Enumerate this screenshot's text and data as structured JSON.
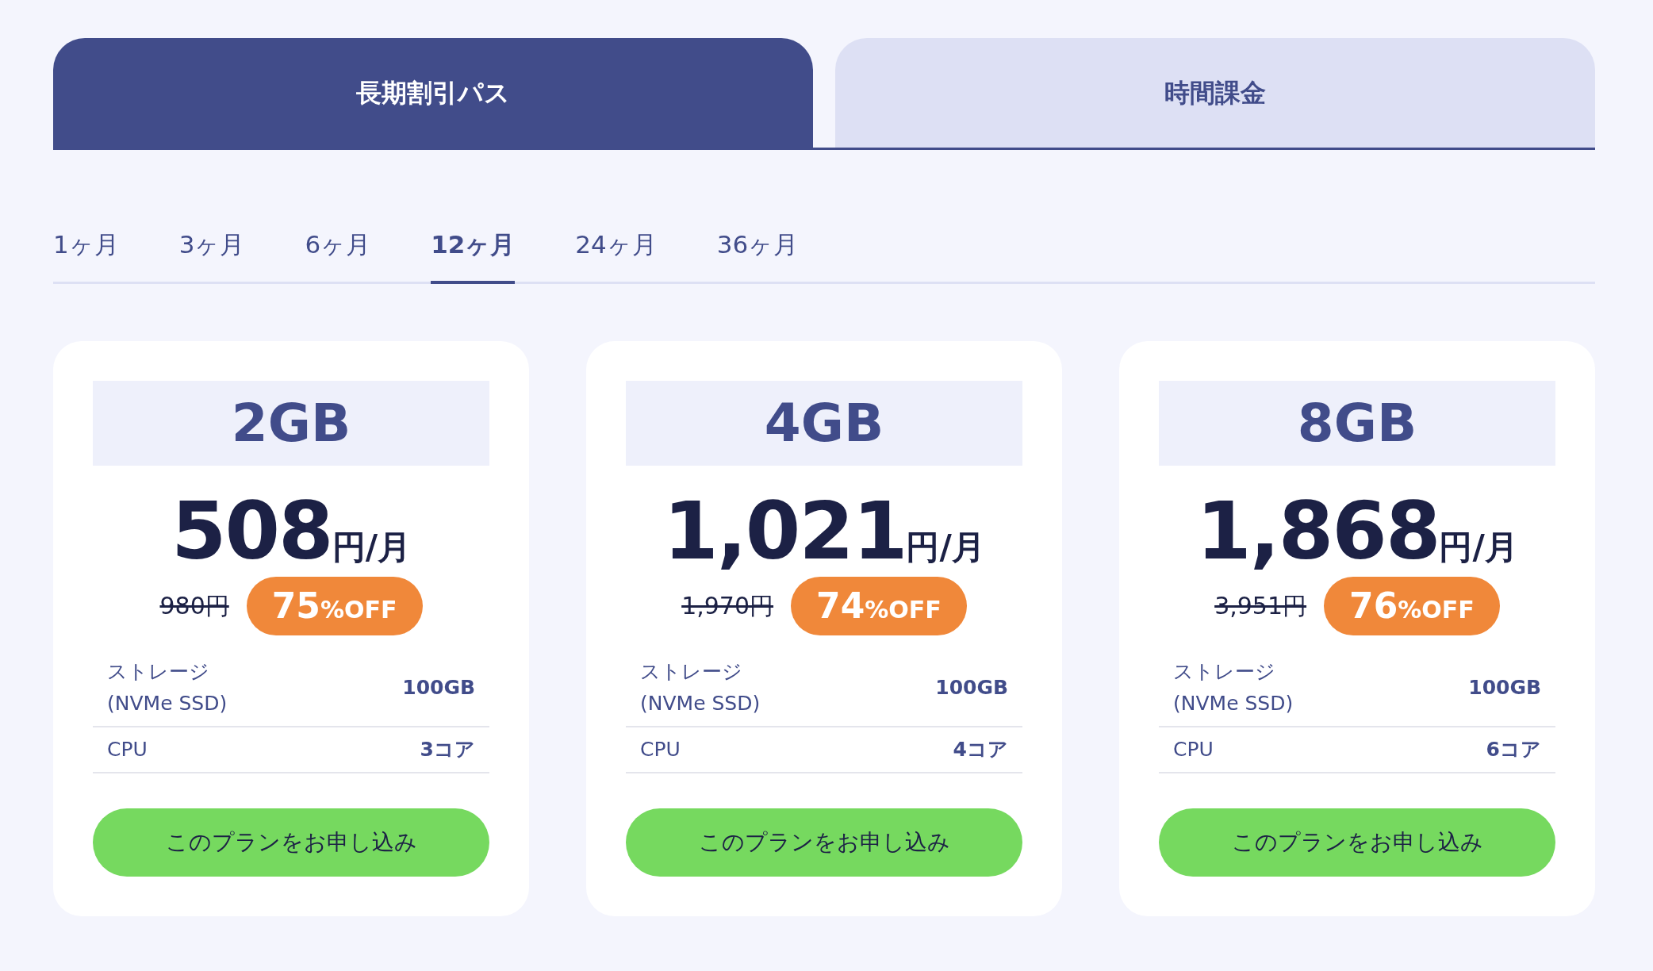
{
  "plan_tabs": [
    {
      "label": "長期割引パス",
      "selected": true
    },
    {
      "label": "時間課金",
      "selected": false
    }
  ],
  "periods": [
    {
      "label": "1ヶ月",
      "selected": false
    },
    {
      "label": "3ヶ月",
      "selected": false
    },
    {
      "label": "6ヶ月",
      "selected": false
    },
    {
      "label": "12ヶ月",
      "selected": true
    },
    {
      "label": "24ヶ月",
      "selected": false
    },
    {
      "label": "36ヶ月",
      "selected": false
    }
  ],
  "plans": [
    {
      "name": "2GB",
      "price": "508",
      "price_unit": "円/月",
      "original_price": "980円",
      "discount": "75",
      "discount_unit": "%OFF",
      "specs": [
        {
          "label": "ストレージ\n(NVMe SSD)",
          "value": "100GB"
        },
        {
          "label": "CPU",
          "value": "3コア"
        }
      ],
      "button": "このプランをお申し込み"
    },
    {
      "name": "4GB",
      "price": "1,021",
      "price_unit": "円/月",
      "original_price": "1,970円",
      "discount": "74",
      "discount_unit": "%OFF",
      "specs": [
        {
          "label": "ストレージ\n(NVMe SSD)",
          "value": "100GB"
        },
        {
          "label": "CPU",
          "value": "4コア"
        }
      ],
      "button": "このプランをお申し込み"
    },
    {
      "name": "8GB",
      "price": "1,868",
      "price_unit": "円/月",
      "original_price": "3,951円",
      "discount": "76",
      "discount_unit": "%OFF",
      "specs": [
        {
          "label": "ストレージ\n(NVMe SSD)",
          "value": "100GB"
        },
        {
          "label": "CPU",
          "value": "6コア"
        }
      ],
      "button": "このプランをお申し込み"
    }
  ]
}
